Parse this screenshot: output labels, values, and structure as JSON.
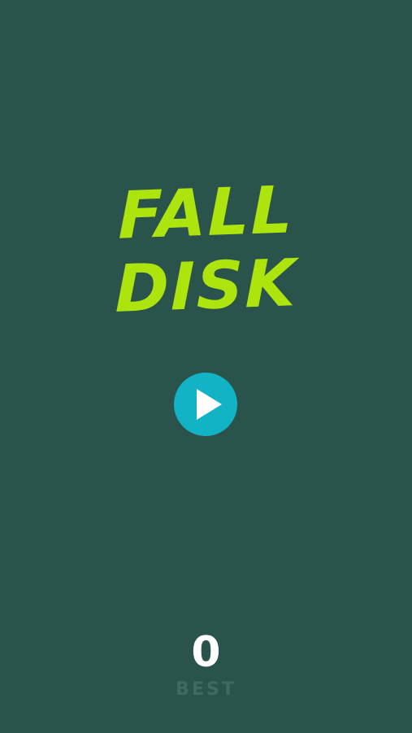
{
  "game": {
    "title_line_1": "FALL",
    "title_line_2": "DISK",
    "play_icon": "play-icon",
    "best_score": "0",
    "best_label": "BEST"
  },
  "colors": {
    "background": "#2a544b",
    "title": "#aee40e",
    "play_button": "#12b3c5",
    "score": "#ffffff",
    "best_label": "#3f6a60"
  }
}
